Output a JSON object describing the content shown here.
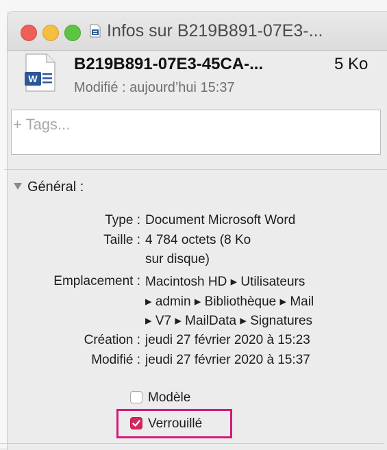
{
  "window": {
    "title": "Infos sur B219B891-07E3-..."
  },
  "file": {
    "name": "B219B891-07E3-45CA-...",
    "size": "5 Ko",
    "modified": "Modifié : aujourd’hui 15:37",
    "icon": "word-document-icon"
  },
  "tags": {
    "placeholder": "+ Tags..."
  },
  "general": {
    "heading": "Général :",
    "rows": [
      {
        "label": "Type :",
        "values": [
          "Document Microsoft Word"
        ]
      },
      {
        "label": "Taille :",
        "values": [
          "4 784 octets (8 Ko",
          "sur disque)"
        ]
      },
      {
        "label": "Emplacement :",
        "values": [
          "Macintosh HD ▸ Utilisateurs",
          "▸ admin ▸ Bibliothèque ▸ Mail",
          "▸ V7 ▸ MailData ▸ Signatures"
        ]
      },
      {
        "label": "Création :",
        "values": [
          "jeudi 27 février 2020 à 15:23"
        ]
      },
      {
        "label": "Modifié :",
        "values": [
          "jeudi 27 février 2020 à 15:37"
        ]
      }
    ],
    "checkboxes": [
      {
        "label": "Modèle",
        "checked": false
      },
      {
        "label": "Verrouillé",
        "checked": true
      }
    ]
  },
  "colors": {
    "close": "#ee5f57",
    "minimize": "#f5bd41",
    "maximize": "#5ec443",
    "checkbox_accent": "#d7265e",
    "highlight": "#d41a7a",
    "word_blue": "#2b5797"
  }
}
